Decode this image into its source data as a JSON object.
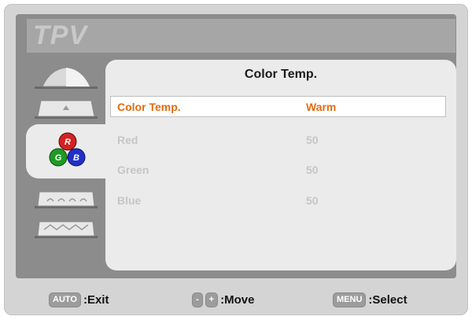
{
  "brand": {
    "logo": "TPV"
  },
  "colors": {
    "selected": "#e06c10",
    "disabled": "#c6c6c6",
    "panel": "#ebebeb",
    "frame": "#8c8c8c"
  },
  "tabs": [
    {
      "icon": "brightness-contrast-icon"
    },
    {
      "icon": "image-setup-icon"
    },
    {
      "icon": "rgb-color-icon",
      "active": true
    },
    {
      "icon": "osd-settings-icon"
    },
    {
      "icon": "extra-settings-icon"
    }
  ],
  "panel": {
    "title": "Color Temp.",
    "items": [
      {
        "label": "Color Temp.",
        "value": "Warm",
        "selected": true
      },
      {
        "label": "Red",
        "value": "50"
      },
      {
        "label": "Green",
        "value": "50"
      },
      {
        "label": "Blue",
        "value": "50"
      }
    ]
  },
  "rgb_icon": {
    "r": "R",
    "g": "G",
    "b": "B"
  },
  "footer": {
    "exit_key": "AUTO",
    "exit_label": ":Exit",
    "move_minus": "-",
    "move_plus": "+",
    "move_label": ":Move",
    "select_key": "MENU",
    "select_label": ":Select"
  }
}
